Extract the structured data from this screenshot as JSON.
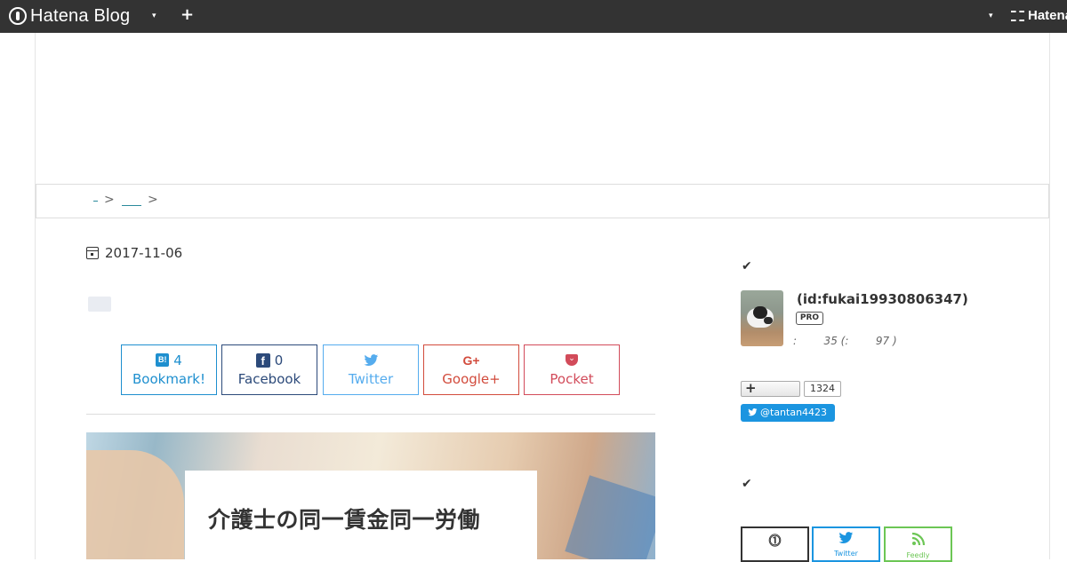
{
  "global_header": {
    "logo_text": "Hatena Blog",
    "caret": "▾",
    "plus": "+",
    "right_caret": "▾",
    "right_brand": "Hatena"
  },
  "breadcrumb": {
    "separator_1": ">",
    "separator_2": ">"
  },
  "article": {
    "date": "2017-11-06",
    "share_buttons": [
      {
        "name": "hatena",
        "icon": "B!",
        "count": "4",
        "label": "Bookmark!",
        "color": "#1e8fcf"
      },
      {
        "name": "facebook",
        "icon": "f",
        "count": "0",
        "label": "Facebook",
        "color": "#2c4a7a"
      },
      {
        "name": "twitter",
        "icon": "🐦",
        "label": "Twitter",
        "color": "#55acee"
      },
      {
        "name": "googleplus",
        "icon": "G+",
        "label": "Google+",
        "color": "#d24b3c"
      },
      {
        "name": "pocket",
        "icon": "⌄",
        "label": "Pocket",
        "color": "#d24b5a"
      }
    ],
    "eyecatch_title": "介護士の同一賃金同一労働"
  },
  "sidebar": {
    "section_icon": "✔",
    "profile": {
      "id": "(id:fukai19930806347)",
      "badge": "PRO",
      "stats": ":        35 (:        97 )"
    },
    "follow": {
      "plus": "+",
      "count": "1324",
      "twitter_follow": "@tantan4423",
      "twitter_bird": "🐦"
    },
    "subscribe": {
      "hatena_icon": "⓵",
      "twitter_label": "Twitter",
      "feedly_label": "Feedly"
    }
  },
  "colors": {
    "header_bg": "#333333",
    "link": "#2b8a9c",
    "twitter_blue": "#1b95e0",
    "feedly_green": "#6cc655"
  }
}
